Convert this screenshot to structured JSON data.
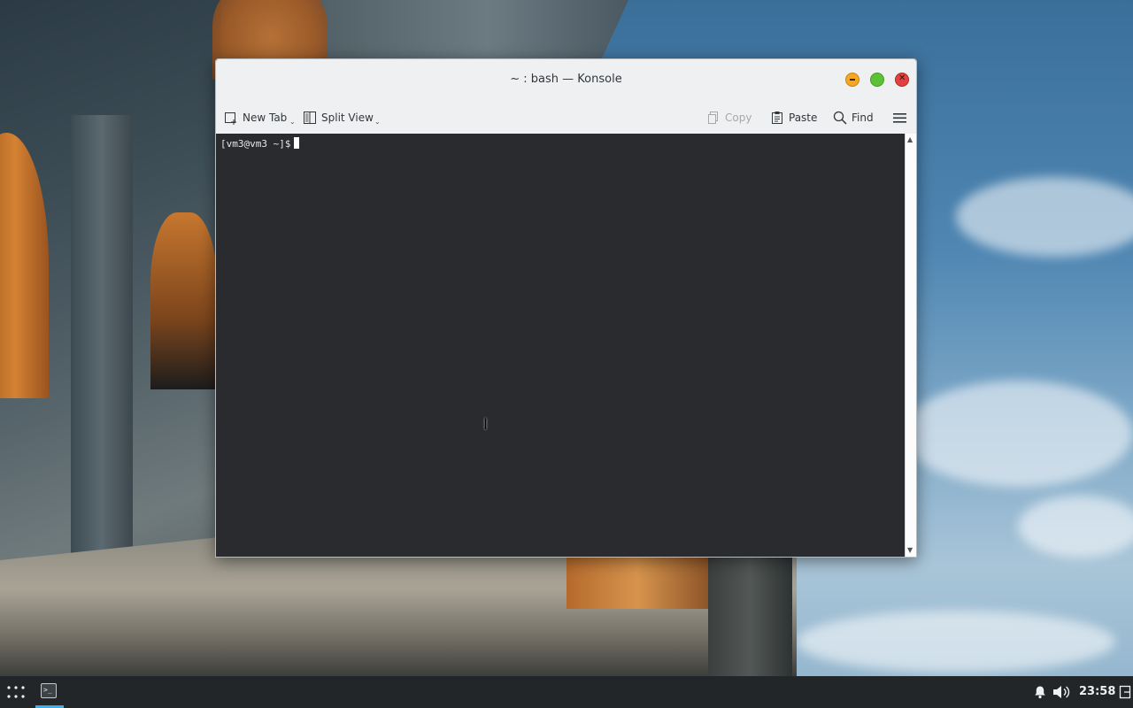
{
  "window": {
    "title": "~ : bash — Konsole"
  },
  "toolbar": {
    "new_tab": "New Tab",
    "split_view": "Split View",
    "copy": "Copy",
    "paste": "Paste",
    "find": "Find"
  },
  "terminal": {
    "prompt": "[vm3@vm3 ~]$"
  },
  "taskbar": {
    "clock": "23:58",
    "accent": "#3daee9"
  },
  "icons": [
    "new-tab-icon",
    "split-view-icon",
    "copy-icon",
    "paste-icon",
    "find-icon",
    "hamburger-menu-icon",
    "app-launcher-icon",
    "konsole-icon",
    "notifications-icon",
    "volume-icon",
    "show-desktop-icon"
  ]
}
